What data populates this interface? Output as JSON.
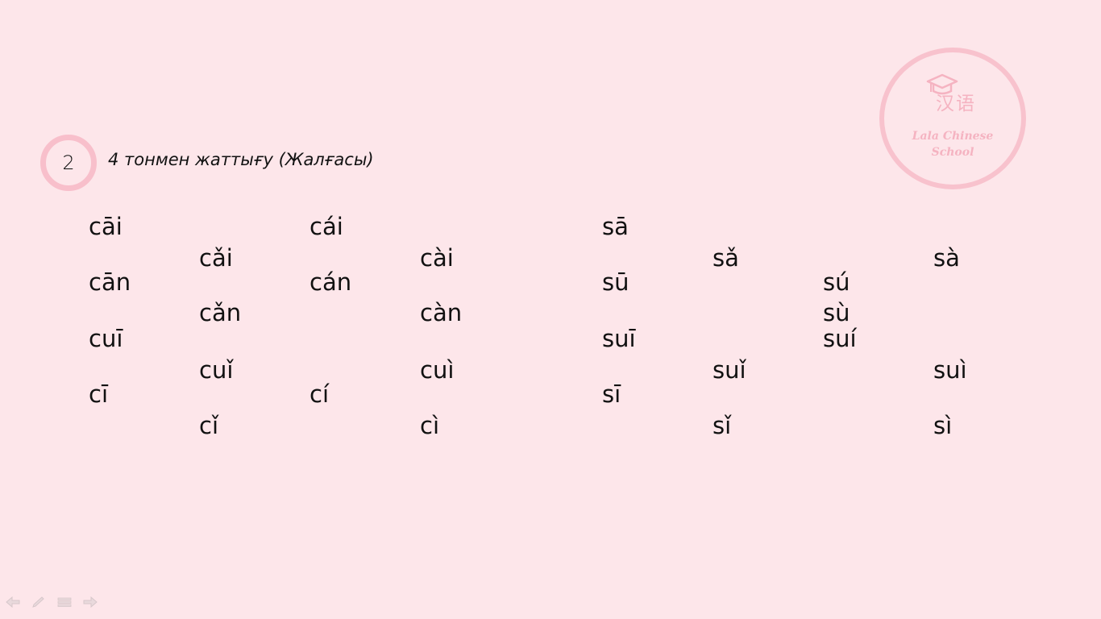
{
  "section": {
    "number": "2",
    "title": "4 тонмен жаттығу (Жалғасы)"
  },
  "logo": {
    "han": "汉语",
    "school_line1": "Lala Chinese",
    "school_line2": "School",
    "accent_color": "#f5b3c1"
  },
  "syllables": {
    "cai1": "cāi",
    "cai2": "cái",
    "cai3": "cǎi",
    "cai4": "cài",
    "can1": "cān",
    "can2": "cán",
    "can3": "cǎn",
    "can4": "càn",
    "cui1": "cuī",
    "cui3": "cuǐ",
    "cui4": "cuì",
    "ci1": "cī",
    "ci2": "cí",
    "ci3": "cǐ",
    "ci4": "cì",
    "sa1": "sā",
    "sa3": "sǎ",
    "sa4": "sà",
    "su1": "sū",
    "su2": "sú",
    "su4": "sù",
    "sui1": "suī",
    "sui2": "suí",
    "sui3": "suǐ",
    "sui4": "suì",
    "si1": "sī",
    "si3": "sǐ",
    "si4": "sì"
  },
  "controls": [
    {
      "name": "prev-slide-icon"
    },
    {
      "name": "pen-icon"
    },
    {
      "name": "menu-icon"
    },
    {
      "name": "next-slide-icon"
    }
  ],
  "colors": {
    "background": "#fde6ea",
    "badge_border": "#f8bfcb",
    "text": "#111111"
  }
}
